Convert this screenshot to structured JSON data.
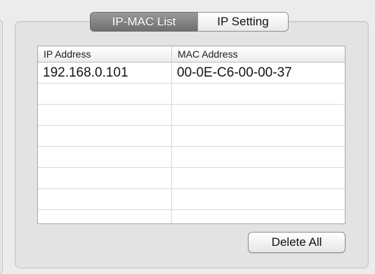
{
  "tabs": [
    {
      "label": "IP-MAC List",
      "active": true
    },
    {
      "label": "IP Setting",
      "active": false
    }
  ],
  "table": {
    "columns": [
      "IP Address",
      "MAC Address"
    ],
    "rows": [
      [
        "192.168.0.101",
        "00-0E-C6-00-00-37"
      ],
      [
        "",
        ""
      ],
      [
        "",
        ""
      ],
      [
        "",
        ""
      ],
      [
        "",
        ""
      ],
      [
        "",
        ""
      ],
      [
        "",
        ""
      ],
      [
        "",
        ""
      ]
    ]
  },
  "actions": {
    "delete_all_label": "Delete All"
  },
  "colors": {
    "active_tab": "#7f7f7f",
    "panel_background": "#e3e3e3",
    "table_background": "#ffffff"
  }
}
